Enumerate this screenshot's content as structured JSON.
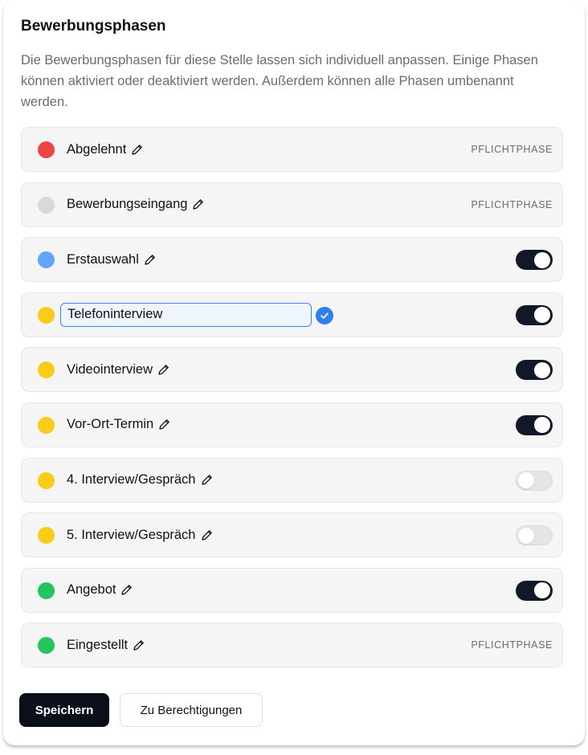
{
  "section": {
    "title": "Bewerbungsphasen",
    "description": "Die Bewerbungsphasen für diese Stelle lassen sich individuell anpassen. Einige Phasen können aktiviert oder deaktiviert werden. Außerdem können alle Phasen umbenannt werden."
  },
  "phases": [
    {
      "name": "Abgelehnt",
      "color": "#ef4444",
      "badge": "PFLICHTPHASE"
    },
    {
      "name": "Bewerbungseingang",
      "color": "#d9d9dc",
      "badge": "PFLICHTPHASE"
    },
    {
      "name": "Erstauswahl",
      "color": "#60a5fa",
      "enabled": true
    },
    {
      "name": "Telefoninterview",
      "color": "#facc15",
      "enabled": true,
      "editing": true
    },
    {
      "name": "Videointerview",
      "color": "#facc15",
      "enabled": true
    },
    {
      "name": "Vor-Ort-Termin",
      "color": "#facc15",
      "enabled": true
    },
    {
      "name": "4. Interview/Gespräch",
      "color": "#facc15",
      "enabled": false
    },
    {
      "name": "5. Interview/Gespräch",
      "color": "#facc15",
      "enabled": false
    },
    {
      "name": "Angebot",
      "color": "#22c55e",
      "enabled": true
    },
    {
      "name": "Eingestellt",
      "color": "#22c55e",
      "badge": "PFLICHTPHASE"
    }
  ],
  "icons": {
    "edit": "pencil-icon",
    "confirm": "check-circle-icon"
  },
  "buttons": {
    "save": "Speichern",
    "permissions": "Zu Berechtigungen"
  }
}
